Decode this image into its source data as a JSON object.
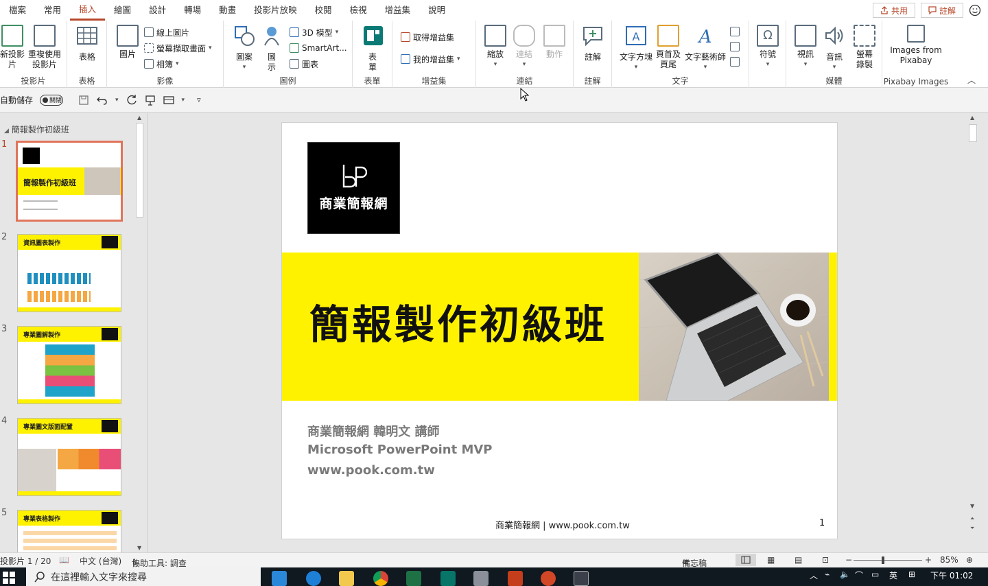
{
  "menu": {
    "tabs": [
      "檔案",
      "常用",
      "插入",
      "繪圖",
      "設計",
      "轉場",
      "動畫",
      "投影片放映",
      "校閱",
      "檢視",
      "增益集",
      "說明"
    ],
    "active_index": 2,
    "share_label": "共用",
    "comment_label": "註解"
  },
  "ribbon": {
    "slides": {
      "new_slide": "新投影片",
      "reuse": "重複使用投影片",
      "label": "投影片"
    },
    "table": {
      "table": "表格",
      "label": "表格"
    },
    "images": {
      "pictures": "圖片",
      "online": "線上圖片",
      "screenshot": "螢幕擷取畫面",
      "album": "相簿",
      "label": "影像"
    },
    "illustrations": {
      "shapes": "圖案",
      "icons": "圖示",
      "model3d": "3D 模型",
      "smartart": "SmartArt...",
      "chart": "圖表",
      "label": "圖例"
    },
    "forms": {
      "forms": "表單",
      "label": "表單"
    },
    "addins": {
      "get": "取得增益集",
      "my": "我的增益集",
      "label": "增益集"
    },
    "links": {
      "zoom": "縮放",
      "link": "連結",
      "action": "動作",
      "label": "連結"
    },
    "comments": {
      "comment": "註解",
      "label": "註解"
    },
    "text": {
      "textbox": "文字方塊",
      "header": "頁首及頁尾",
      "wordart": "文字藝術師",
      "label": "文字"
    },
    "symbols": {
      "symbol": "符號"
    },
    "media": {
      "video": "視訊",
      "audio": "音訊",
      "record": "螢幕錄製",
      "label": "媒體"
    },
    "pixabay": {
      "button": "Images from Pixabay",
      "label": "Pixabay Images"
    }
  },
  "qat": {
    "autosave": "自動儲存",
    "toggle": "關閉"
  },
  "slides_pane": {
    "section": "簡報製作初級班",
    "thumbnails": [
      {
        "num": "1",
        "title": "簡報製作初級班"
      },
      {
        "num": "2",
        "title": "資訊圖表製作"
      },
      {
        "num": "3",
        "title": "專業圖解製作"
      },
      {
        "num": "4",
        "title": "專業圖文版面配置"
      },
      {
        "num": "5",
        "title": "專業表格製作"
      }
    ]
  },
  "slide": {
    "logo_text": "商業簡報網",
    "title": "簡報製作初級班",
    "line1": "商業簡報網 韓明文 講師",
    "line2": "Microsoft PowerPoint MVP",
    "line3": "www.pook.com.tw",
    "footer": "商業簡報網 | www.pook.com.tw",
    "page": "1"
  },
  "status": {
    "slide_count": "投影片 1 / 20",
    "language": "中文 (台灣)",
    "accessibility": "協助工具: 調查",
    "notes": "備忘稿",
    "zoom": "85%"
  },
  "taskbar": {
    "search_placeholder": "在這裡輸入文字來搜尋",
    "time": "下午 01:02",
    "ime": "英"
  },
  "colors": {
    "accent": "#b7472a",
    "yellow": "#fff200",
    "selection": "#e0745a"
  }
}
